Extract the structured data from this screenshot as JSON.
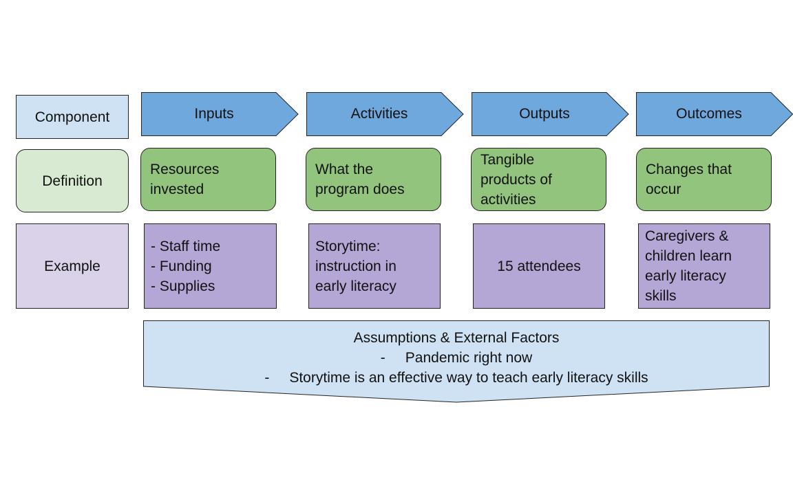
{
  "row_labels": {
    "component": "Component",
    "definition": "Definition",
    "example": "Example"
  },
  "stages": [
    {
      "title": "Inputs",
      "definition": "Resources\ninvested",
      "example": "- Staff time\n- Funding\n- Supplies"
    },
    {
      "title": "Activities",
      "definition": "What the\nprogram does",
      "example": "Storytime:\ninstruction in\nearly literacy"
    },
    {
      "title": "Outputs",
      "definition": "Tangible\nproducts of\nactivities",
      "example": "15 attendees"
    },
    {
      "title": "Outcomes",
      "definition": "Changes that\noccur",
      "example": "Caregivers &\nchildren learn\nearly literacy\nskills"
    }
  ],
  "assumptions": {
    "title": "Assumptions & External Factors",
    "bullets": [
      {
        "dash": "-",
        "text": "Pandemic right now"
      },
      {
        "dash": "-",
        "text": "Storytime is an effective way to teach early literacy skills"
      }
    ]
  },
  "colors": {
    "chevron": "#6fa8dc",
    "component_label": "#cfe2f3",
    "definition_label": "#d9ead3",
    "definition_box": "#93c47d",
    "example_label": "#d9d2e9",
    "example_box": "#b4a7d6",
    "assumptions_box": "#cfe2f3"
  }
}
